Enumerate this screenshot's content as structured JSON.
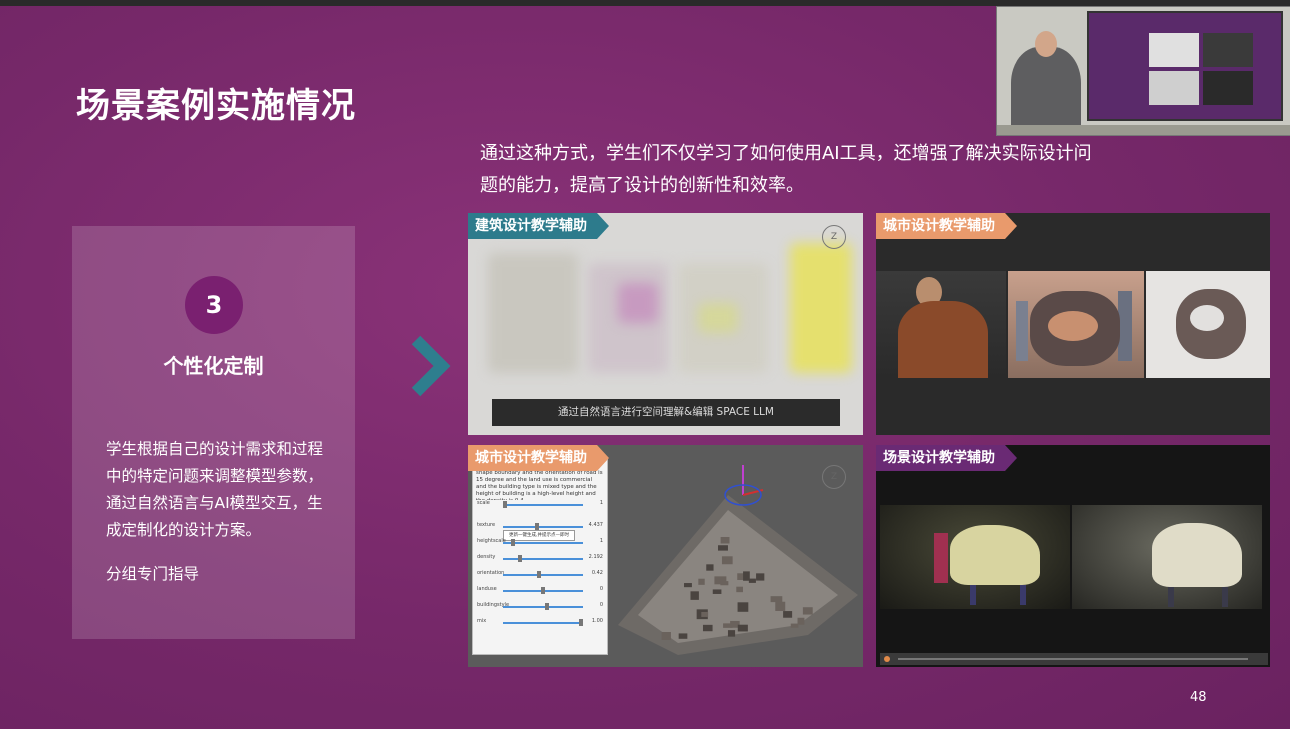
{
  "slide": {
    "title": "场景案例实施情况",
    "intro": "通过这种方式，学生们不仅学习了如何使用AI工具，还增强了解决实际设计问题的能力，提高了设计的创新性和效率。",
    "page_number": "48"
  },
  "card": {
    "number": "3",
    "title": "个性化定制",
    "description": "学生根据自己的设计需求和过程中的特定问题来调整模型参数，通过自然语言与AI模型交互，生成定制化的设计方案。",
    "note": "分组专门指导"
  },
  "panels": {
    "architecture": {
      "tag": "建筑设计教学辅助",
      "caption": "通过自然语言进行空间理解&编辑   SPACE LLM"
    },
    "urban_1": {
      "tag": "城市设计教学辅助"
    },
    "urban_2": {
      "tag": "城市设计教学辅助",
      "ui_text": "Design a city, the boundary is a triangle shape boundary and the orientation of road is 15 degree and the land use is commercial and the building type is mixed type and the height of building is a high-level height and the density is 0.4",
      "apply_label": "更新一键生成,并提示点—即时",
      "sliders": [
        {
          "label": "scale",
          "value": "1",
          "pos": 0.0
        },
        {
          "label": "texture",
          "value": "4.437",
          "pos": 0.42
        },
        {
          "label": "heightscale",
          "value": "1",
          "pos": 0.1
        },
        {
          "label": "density",
          "value": "2.192",
          "pos": 0.2
        },
        {
          "label": "orientation",
          "value": "0.42",
          "pos": 0.45
        },
        {
          "label": "landuse",
          "value": "0",
          "pos": 0.5
        },
        {
          "label": "buildingstyle",
          "value": "0",
          "pos": 0.55
        },
        {
          "label": "mix",
          "value": "1.00",
          "pos": 1.0
        }
      ]
    },
    "scene": {
      "tag": "场景设计教学辅助"
    }
  },
  "colors": {
    "background": "#7a2a6a",
    "teal_tag": "#2d7b8c",
    "orange_tag": "#e99a6c",
    "purple_tag": "#6a2a74",
    "chevron": "#2e7e8e"
  }
}
